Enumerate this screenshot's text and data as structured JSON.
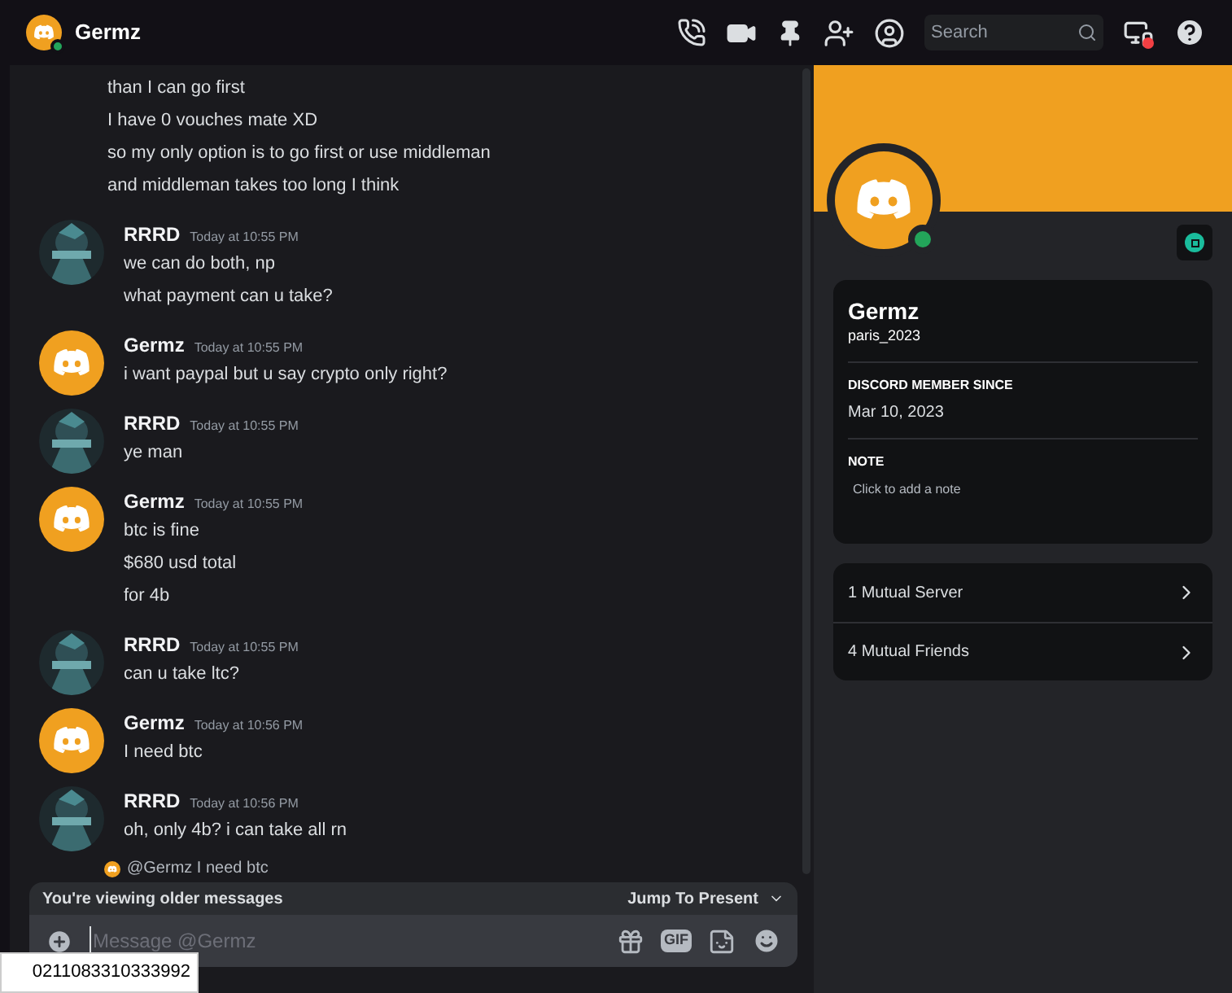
{
  "header": {
    "title": "Germz",
    "search": {
      "placeholder": "Search"
    }
  },
  "messages": [
    {
      "kind": "continuation",
      "lines": [
        "than I can go first",
        "I have 0 vouches mate XD",
        "so my only option is to go first or use middleman",
        "and middleman takes too long I think"
      ]
    },
    {
      "kind": "picture",
      "author": "RRRD",
      "time": "Today at 10:55 PM",
      "lines": [
        "we can do both, np",
        "what payment can u take?"
      ]
    },
    {
      "kind": "default",
      "author": "Germz",
      "time": "Today at 10:55 PM",
      "lines": [
        "i want paypal but u say crypto only right?"
      ]
    },
    {
      "kind": "picture",
      "author": "RRRD",
      "time": "Today at 10:55 PM",
      "lines": [
        "ye man"
      ]
    },
    {
      "kind": "default",
      "author": "Germz",
      "time": "Today at 10:55 PM",
      "lines": [
        "btc is fine",
        "$680 usd total",
        "for 4b"
      ]
    },
    {
      "kind": "picture",
      "author": "RRRD",
      "time": "Today at 10:55 PM",
      "lines": [
        "can u take ltc?"
      ]
    },
    {
      "kind": "default",
      "author": "Germz",
      "time": "Today at 10:56 PM",
      "lines": [
        "I need btc"
      ]
    },
    {
      "kind": "picture",
      "author": "RRRD",
      "time": "Today at 10:56 PM",
      "lines": [
        "oh, only 4b? i can take all rn"
      ]
    }
  ],
  "reply_preview": "@Germz I need btc",
  "older_banner": {
    "text": "You're viewing older messages",
    "action": "Jump To Present"
  },
  "composer": {
    "placeholder": "Message @Germz",
    "gif": "GIF"
  },
  "tooltip": "0211083310333992",
  "profile": {
    "online": true,
    "name": "Germz",
    "username": "paris_2023",
    "member_since_label": "DISCORD MEMBER SINCE",
    "member_since": "Mar 10, 2023",
    "note_label": "NOTE",
    "note_placeholder": "Click to add a note",
    "mutuals": [
      "1 Mutual Server",
      "4 Mutual Friends"
    ]
  }
}
